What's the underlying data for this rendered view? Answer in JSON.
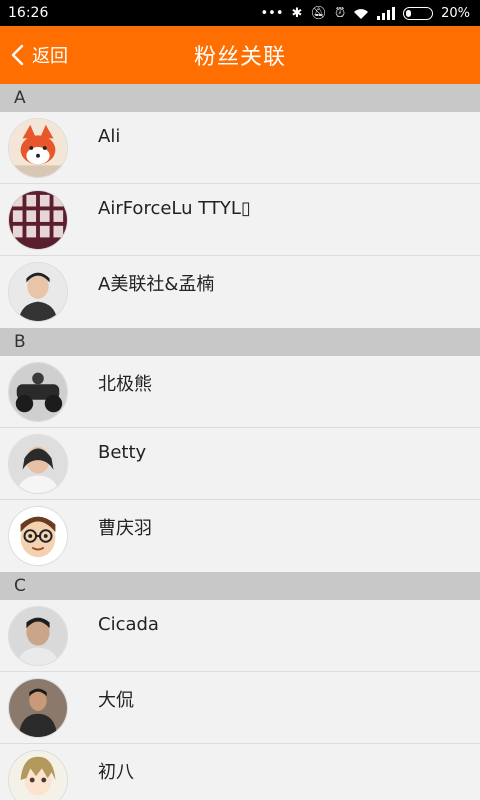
{
  "status_bar": {
    "time": "16:26",
    "battery": "20%",
    "battery_level": 0.2
  },
  "header": {
    "back_label": "返回",
    "title": "粉丝关联"
  },
  "sections": [
    {
      "letter": "A",
      "items": [
        {
          "name": "Ali",
          "avatar": "fox-cartoon-avatar"
        },
        {
          "name": "AirForceLu TTYL▯",
          "avatar": "photo-grid-avatar"
        },
        {
          "name": "A美联社&孟楠",
          "avatar": "man-portrait-avatar"
        }
      ]
    },
    {
      "letter": "B",
      "items": [
        {
          "name": "北极熊",
          "avatar": "motorcycle-avatar"
        },
        {
          "name": "Betty",
          "avatar": "woman-portrait-avatar"
        },
        {
          "name": "曹庆羽",
          "avatar": "glasses-cartoon-avatar"
        }
      ]
    },
    {
      "letter": "C",
      "items": [
        {
          "name": "Cicada",
          "avatar": "man-portrait-avatar"
        },
        {
          "name": "大侃",
          "avatar": "man-sitting-avatar"
        },
        {
          "name": "初八",
          "avatar": "anime-girl-avatar"
        }
      ]
    }
  ],
  "colors": {
    "accent": "#ff6e00",
    "section_bg": "#c8c8c8",
    "row_bg": "#f2f2f2"
  }
}
